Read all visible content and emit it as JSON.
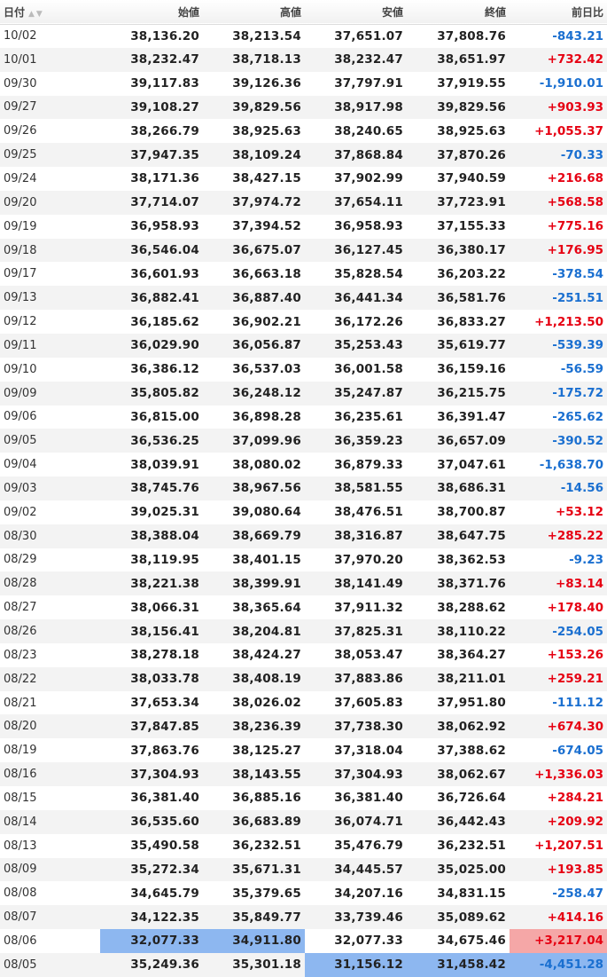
{
  "header": {
    "date": "日付",
    "open": "始値",
    "high": "高値",
    "low": "安値",
    "close": "終値",
    "change": "前日比"
  },
  "rows": [
    {
      "date": "10/02",
      "open": "38,136.20",
      "high": "38,213.54",
      "low": "37,651.07",
      "close": "37,808.76",
      "change": "-843.21"
    },
    {
      "date": "10/01",
      "open": "38,232.47",
      "high": "38,718.13",
      "low": "38,232.47",
      "close": "38,651.97",
      "change": "+732.42"
    },
    {
      "date": "09/30",
      "open": "39,117.83",
      "high": "39,126.36",
      "low": "37,797.91",
      "close": "37,919.55",
      "change": "-1,910.01"
    },
    {
      "date": "09/27",
      "open": "39,108.27",
      "high": "39,829.56",
      "low": "38,917.98",
      "close": "39,829.56",
      "change": "+903.93"
    },
    {
      "date": "09/26",
      "open": "38,266.79",
      "high": "38,925.63",
      "low": "38,240.65",
      "close": "38,925.63",
      "change": "+1,055.37"
    },
    {
      "date": "09/25",
      "open": "37,947.35",
      "high": "38,109.24",
      "low": "37,868.84",
      "close": "37,870.26",
      "change": "-70.33"
    },
    {
      "date": "09/24",
      "open": "38,171.36",
      "high": "38,427.15",
      "low": "37,902.99",
      "close": "37,940.59",
      "change": "+216.68"
    },
    {
      "date": "09/20",
      "open": "37,714.07",
      "high": "37,974.72",
      "low": "37,654.11",
      "close": "37,723.91",
      "change": "+568.58"
    },
    {
      "date": "09/19",
      "open": "36,958.93",
      "high": "37,394.52",
      "low": "36,958.93",
      "close": "37,155.33",
      "change": "+775.16"
    },
    {
      "date": "09/18",
      "open": "36,546.04",
      "high": "36,675.07",
      "low": "36,127.45",
      "close": "36,380.17",
      "change": "+176.95"
    },
    {
      "date": "09/17",
      "open": "36,601.93",
      "high": "36,663.18",
      "low": "35,828.54",
      "close": "36,203.22",
      "change": "-378.54"
    },
    {
      "date": "09/13",
      "open": "36,882.41",
      "high": "36,887.40",
      "low": "36,441.34",
      "close": "36,581.76",
      "change": "-251.51"
    },
    {
      "date": "09/12",
      "open": "36,185.62",
      "high": "36,902.21",
      "low": "36,172.26",
      "close": "36,833.27",
      "change": "+1,213.50"
    },
    {
      "date": "09/11",
      "open": "36,029.90",
      "high": "36,056.87",
      "low": "35,253.43",
      "close": "35,619.77",
      "change": "-539.39"
    },
    {
      "date": "09/10",
      "open": "36,386.12",
      "high": "36,537.03",
      "low": "36,001.58",
      "close": "36,159.16",
      "change": "-56.59"
    },
    {
      "date": "09/09",
      "open": "35,805.82",
      "high": "36,248.12",
      "low": "35,247.87",
      "close": "36,215.75",
      "change": "-175.72"
    },
    {
      "date": "09/06",
      "open": "36,815.00",
      "high": "36,898.28",
      "low": "36,235.61",
      "close": "36,391.47",
      "change": "-265.62"
    },
    {
      "date": "09/05",
      "open": "36,536.25",
      "high": "37,099.96",
      "low": "36,359.23",
      "close": "36,657.09",
      "change": "-390.52"
    },
    {
      "date": "09/04",
      "open": "38,039.91",
      "high": "38,080.02",
      "low": "36,879.33",
      "close": "37,047.61",
      "change": "-1,638.70"
    },
    {
      "date": "09/03",
      "open": "38,745.76",
      "high": "38,967.56",
      "low": "38,581.55",
      "close": "38,686.31",
      "change": "-14.56"
    },
    {
      "date": "09/02",
      "open": "39,025.31",
      "high": "39,080.64",
      "low": "38,476.51",
      "close": "38,700.87",
      "change": "+53.12"
    },
    {
      "date": "08/30",
      "open": "38,388.04",
      "high": "38,669.79",
      "low": "38,316.87",
      "close": "38,647.75",
      "change": "+285.22"
    },
    {
      "date": "08/29",
      "open": "38,119.95",
      "high": "38,401.15",
      "low": "37,970.20",
      "close": "38,362.53",
      "change": "-9.23"
    },
    {
      "date": "08/28",
      "open": "38,221.38",
      "high": "38,399.91",
      "low": "38,141.49",
      "close": "38,371.76",
      "change": "+83.14"
    },
    {
      "date": "08/27",
      "open": "38,066.31",
      "high": "38,365.64",
      "low": "37,911.32",
      "close": "38,288.62",
      "change": "+178.40"
    },
    {
      "date": "08/26",
      "open": "38,156.41",
      "high": "38,204.81",
      "low": "37,825.31",
      "close": "38,110.22",
      "change": "-254.05"
    },
    {
      "date": "08/23",
      "open": "38,278.18",
      "high": "38,424.27",
      "low": "38,053.47",
      "close": "38,364.27",
      "change": "+153.26"
    },
    {
      "date": "08/22",
      "open": "38,033.78",
      "high": "38,408.19",
      "low": "37,883.86",
      "close": "38,211.01",
      "change": "+259.21"
    },
    {
      "date": "08/21",
      "open": "37,653.34",
      "high": "38,026.02",
      "low": "37,605.83",
      "close": "37,951.80",
      "change": "-111.12"
    },
    {
      "date": "08/20",
      "open": "37,847.85",
      "high": "38,236.39",
      "low": "37,738.30",
      "close": "38,062.92",
      "change": "+674.30"
    },
    {
      "date": "08/19",
      "open": "37,863.76",
      "high": "38,125.27",
      "low": "37,318.04",
      "close": "37,388.62",
      "change": "-674.05"
    },
    {
      "date": "08/16",
      "open": "37,304.93",
      "high": "38,143.55",
      "low": "37,304.93",
      "close": "38,062.67",
      "change": "+1,336.03"
    },
    {
      "date": "08/15",
      "open": "36,381.40",
      "high": "36,885.16",
      "low": "36,381.40",
      "close": "36,726.64",
      "change": "+284.21"
    },
    {
      "date": "08/14",
      "open": "36,535.60",
      "high": "36,683.89",
      "low": "36,074.71",
      "close": "36,442.43",
      "change": "+209.92"
    },
    {
      "date": "08/13",
      "open": "35,490.58",
      "high": "36,232.51",
      "low": "35,476.79",
      "close": "36,232.51",
      "change": "+1,207.51"
    },
    {
      "date": "08/09",
      "open": "35,272.34",
      "high": "35,671.31",
      "low": "34,445.57",
      "close": "35,025.00",
      "change": "+193.85"
    },
    {
      "date": "08/08",
      "open": "34,645.79",
      "high": "35,379.65",
      "low": "34,207.16",
      "close": "34,831.15",
      "change": "-258.47"
    },
    {
      "date": "08/07",
      "open": "34,122.35",
      "high": "35,849.77",
      "low": "33,739.46",
      "close": "35,089.62",
      "change": "+414.16"
    },
    {
      "date": "08/06",
      "open": "32,077.33",
      "high": "34,911.80",
      "low": "32,077.33",
      "close": "34,675.46",
      "change": "+3,217.04",
      "highlight": [
        "open",
        "high",
        "change"
      ]
    },
    {
      "date": "08/05",
      "open": "35,249.36",
      "high": "35,301.18",
      "low": "31,156.12",
      "close": "31,458.42",
      "change": "-4,451.28",
      "highlight": [
        "low",
        "close",
        "change"
      ]
    }
  ],
  "colors": {
    "up": "#e60012",
    "down": "#1a6fd0",
    "highlight_blue": "#8db7f0",
    "highlight_red": "#f5a7a7"
  },
  "icons": {
    "sort": "sort-arrows-icon"
  }
}
